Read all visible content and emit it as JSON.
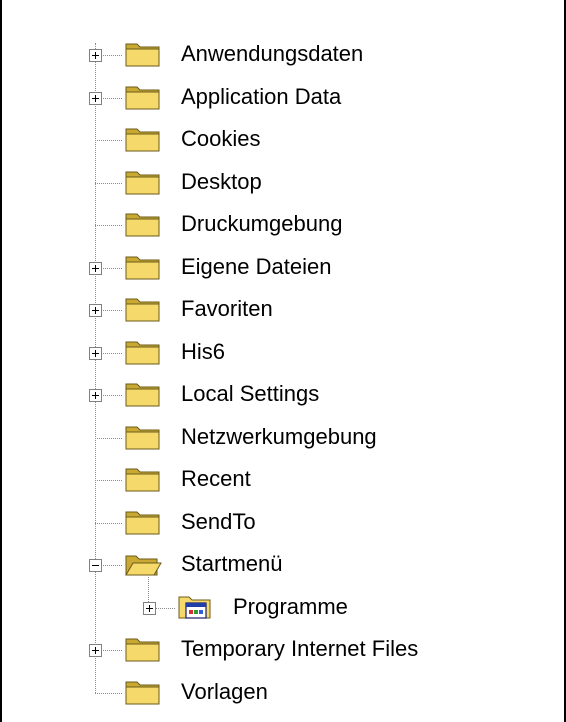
{
  "tree": {
    "items": [
      {
        "label": "Anwendungsdaten",
        "expander": "plus",
        "icon": "folder-icon"
      },
      {
        "label": "Application Data",
        "expander": "plus",
        "icon": "folder-icon"
      },
      {
        "label": "Cookies",
        "expander": "none",
        "icon": "folder-icon"
      },
      {
        "label": "Desktop",
        "expander": "none",
        "icon": "folder-icon"
      },
      {
        "label": "Druckumgebung",
        "expander": "none",
        "icon": "folder-icon"
      },
      {
        "label": "Eigene Dateien",
        "expander": "plus",
        "icon": "folder-icon"
      },
      {
        "label": "Favoriten",
        "expander": "plus",
        "icon": "folder-icon"
      },
      {
        "label": "His6",
        "expander": "plus",
        "icon": "folder-icon"
      },
      {
        "label": "Local Settings",
        "expander": "plus",
        "icon": "folder-icon"
      },
      {
        "label": "Netzwerkumgebung",
        "expander": "none",
        "icon": "folder-icon"
      },
      {
        "label": "Recent",
        "expander": "none",
        "icon": "folder-icon"
      },
      {
        "label": "SendTo",
        "expander": "none",
        "icon": "folder-icon"
      },
      {
        "label": "Startmenü",
        "expander": "minus",
        "icon": "open-folder-icon"
      },
      {
        "label": "Programme",
        "expander": "plus",
        "icon": "program-group-icon",
        "child": true
      },
      {
        "label": "Temporary Internet Files",
        "expander": "plus",
        "icon": "folder-icon"
      },
      {
        "label": "Vorlagen",
        "expander": "none",
        "icon": "folder-icon"
      }
    ]
  },
  "colors": {
    "folder_fill": "#f6d96b",
    "folder_shade": "#c9a934",
    "folder_outline": "#6b5a1a",
    "tree_line": "#8a8a8a"
  }
}
